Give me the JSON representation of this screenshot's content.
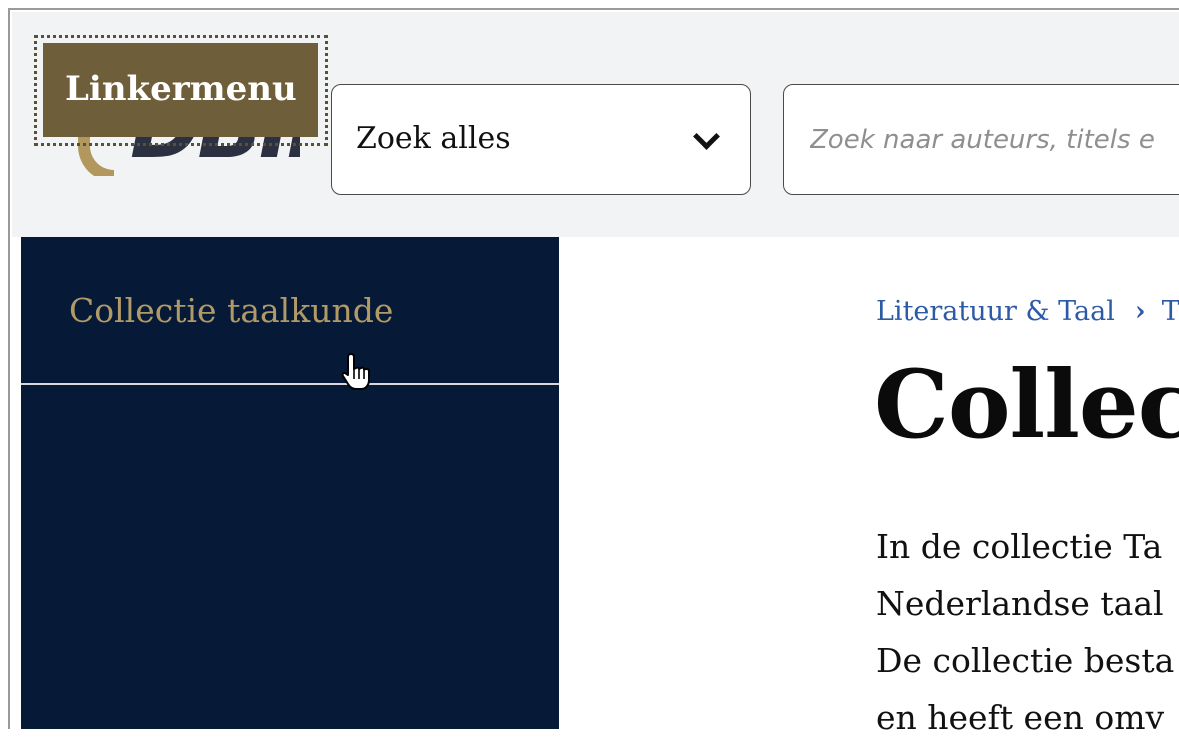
{
  "header": {
    "skip_link_label": "Linkermenu",
    "logo_text": "DBII",
    "search_scope": {
      "selected": "Zoek alles"
    },
    "search_input": {
      "placeholder": "Zoek naar auteurs, titels e",
      "value": ""
    }
  },
  "sidebar": {
    "items": [
      {
        "label": "Collectie taalkunde"
      }
    ]
  },
  "main": {
    "breadcrumb": [
      {
        "label": "Literatuur & Taal"
      },
      {
        "label": "T"
      }
    ],
    "breadcrumb_separator": "›",
    "title": "Collect",
    "intro_lines": [
      "In de collectie Ta",
      "Nederlandse taal",
      "De collectie besta",
      "en heeft een omv"
    ]
  },
  "colors": {
    "header_bg": "#f2f3f5",
    "sidebar_bg": "#061a38",
    "sidebar_text": "#b29a66",
    "skip_link_bg": "#6e5e3a",
    "breadcrumb_link": "#2c5aa6"
  },
  "icons": {
    "select_chevron": "chevron-down-icon",
    "cursor": "hand-pointer-icon"
  }
}
